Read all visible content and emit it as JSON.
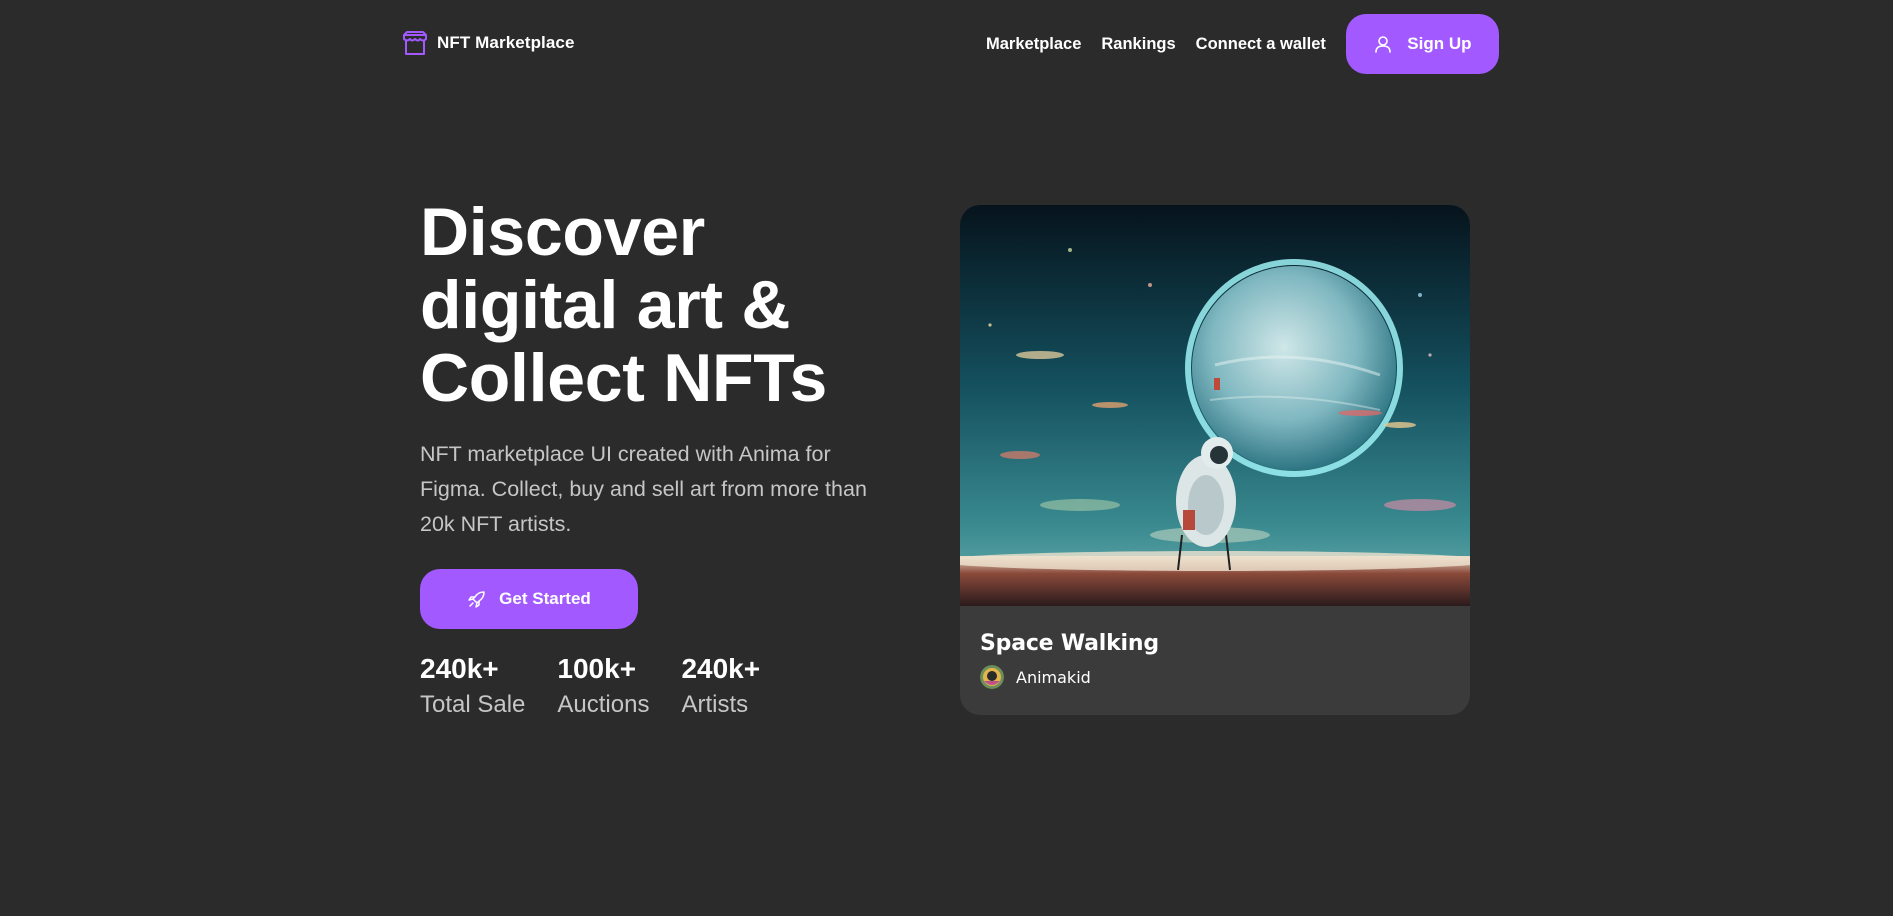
{
  "header": {
    "brand_name": "NFT Marketplace",
    "brand_icon": "storefront-icon",
    "nav": [
      {
        "label": "Marketplace"
      },
      {
        "label": "Rankings"
      },
      {
        "label": "Connect a wallet"
      }
    ],
    "signup_label": "Sign Up",
    "signup_icon": "user-icon"
  },
  "hero": {
    "title": "Discover\ndigital art &\nCollect NFTs",
    "description": "NFT marketplace UI created with Anima for Figma. Collect, buy and sell art from more than 20k NFT artists.",
    "cta_label": "Get Started",
    "cta_icon": "rocket-icon",
    "stats": [
      {
        "value": "240k+",
        "label": "Total Sale"
      },
      {
        "value": "100k+",
        "label": "Auctions"
      },
      {
        "value": "240k+",
        "label": "Artists"
      }
    ]
  },
  "card": {
    "title": "Space Walking",
    "artist": "Animakid",
    "image": "astronaut-planet-artwork"
  },
  "colors": {
    "background": "#2b2b2b",
    "accent": "#a259ff",
    "card_bg": "#3b3b3b",
    "muted_text": "#c6c6c6"
  }
}
